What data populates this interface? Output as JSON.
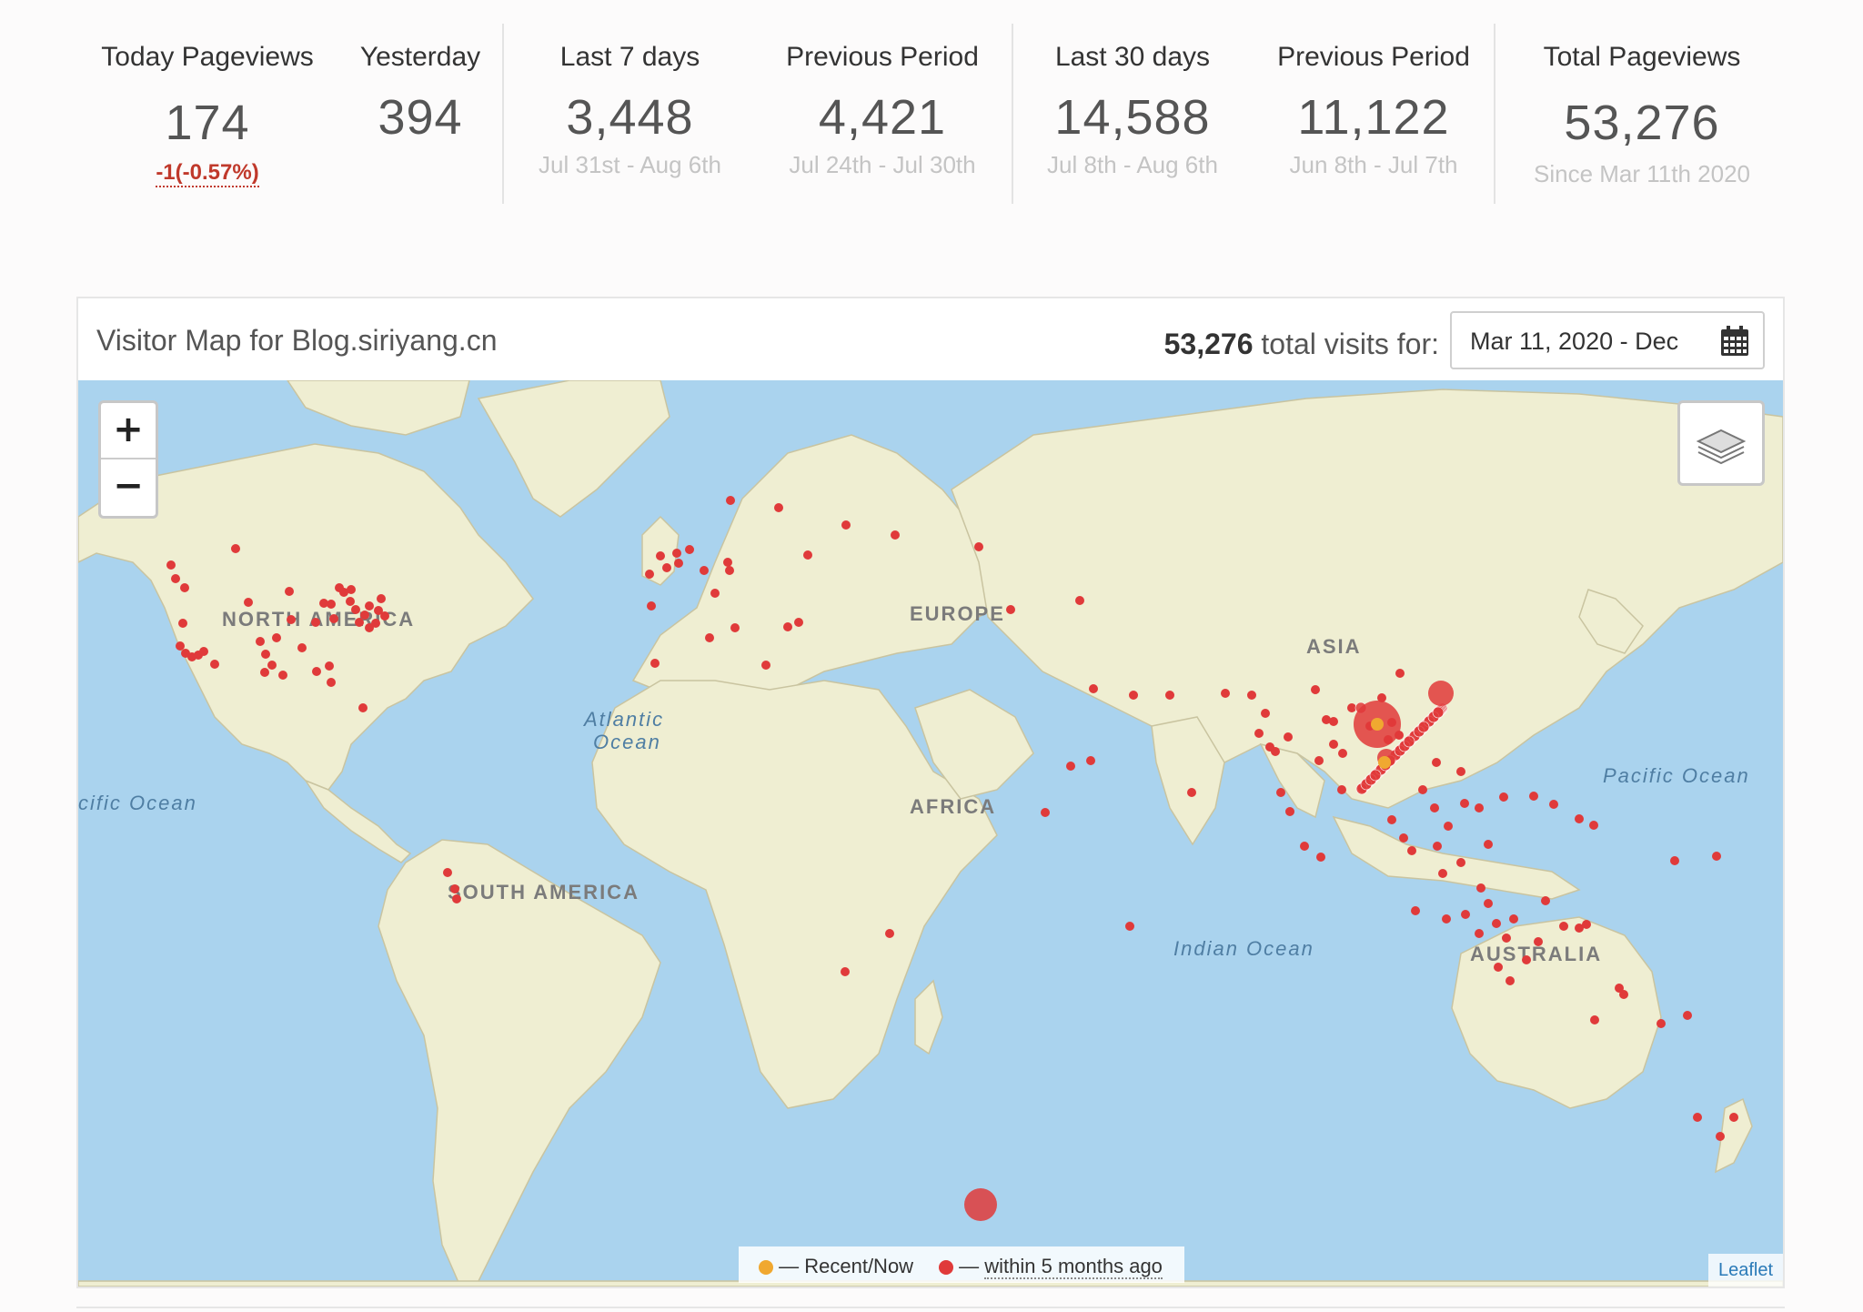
{
  "stats": [
    {
      "label": "Today Pageviews",
      "value": "174",
      "change": "-1(-0.57%)"
    },
    {
      "label": "Yesterday",
      "value": "394"
    },
    {
      "label": "Last 7 days",
      "value": "3,448",
      "sub": "Jul 31st - Aug 6th"
    },
    {
      "label": "Previous Period",
      "value": "4,421",
      "sub": "Jul 24th - Jul 30th"
    },
    {
      "label": "Last 30 days",
      "value": "14,588",
      "sub": "Jul 8th - Aug 6th"
    },
    {
      "label": "Previous Period",
      "value": "11,122",
      "sub": "Jun 8th - Jul 7th"
    },
    {
      "label": "Total Pageviews",
      "value": "53,276",
      "sub": "Since Mar 11th 2020"
    }
  ],
  "panel": {
    "title": "Visitor Map for Blog.siriyang.cn",
    "total_visits": "53,276",
    "visits_suffix": "total visits for:",
    "date_range": "Mar 11, 2020 - Dec"
  },
  "map": {
    "labels": {
      "north_america": "NORTH AMERICA",
      "europe": "EUROPE",
      "asia": "ASIA",
      "africa": "AFRICA",
      "south_america": "SOUTH AMERICA",
      "australia": "AUSTRALIA",
      "atlantic_1": "Atlantic",
      "atlantic_2": "Ocean",
      "pacific_east": "Pacific Ocean",
      "pacific_west": "cific Ocean",
      "indian": "Indian Ocean"
    },
    "zoom_in": "+",
    "zoom_out": "−",
    "layers_icon": "layers-icon",
    "legend": {
      "recent": "— Recent/Now",
      "older_prefix": "— ",
      "older": "within 5 months ago"
    },
    "attribution": "Leaflet",
    "colors": {
      "ocean": "#aad3ee",
      "land": "#efeed2",
      "visitor_recent": "#f0a830",
      "visitor_old": "#e03a3a"
    }
  }
}
